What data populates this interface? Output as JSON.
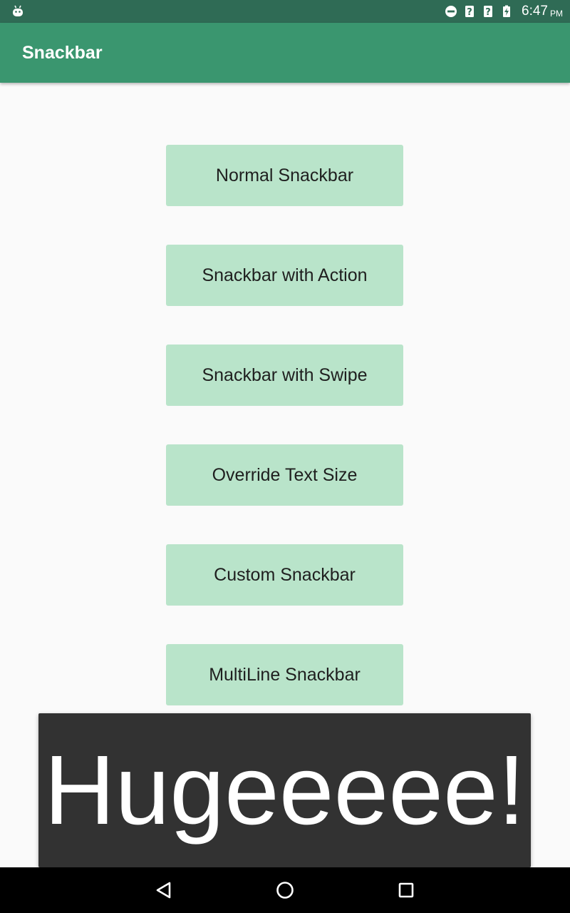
{
  "status_bar": {
    "time": "6:47",
    "ampm": "PM",
    "icons": [
      "android-icon",
      "do-not-disturb-icon",
      "unknown-signal-icon",
      "unknown-signal-icon",
      "battery-charging-icon"
    ]
  },
  "app_bar": {
    "title": "Snackbar"
  },
  "buttons": [
    {
      "label": "Normal Snackbar"
    },
    {
      "label": "Snackbar with Action"
    },
    {
      "label": "Snackbar with Swipe"
    },
    {
      "label": "Override Text Size"
    },
    {
      "label": "Custom Snackbar"
    },
    {
      "label": "MultiLine Snackbar"
    }
  ],
  "snackbar": {
    "message": "Hugeeeee!"
  },
  "nav_bar": {
    "icons": [
      "back-icon",
      "home-icon",
      "recents-icon"
    ]
  },
  "colors": {
    "status_bar": "#2f6b55",
    "app_bar": "#3a966f",
    "button_bg": "#b9e4ca",
    "snackbar_bg": "#323232",
    "background": "#fafafa"
  }
}
